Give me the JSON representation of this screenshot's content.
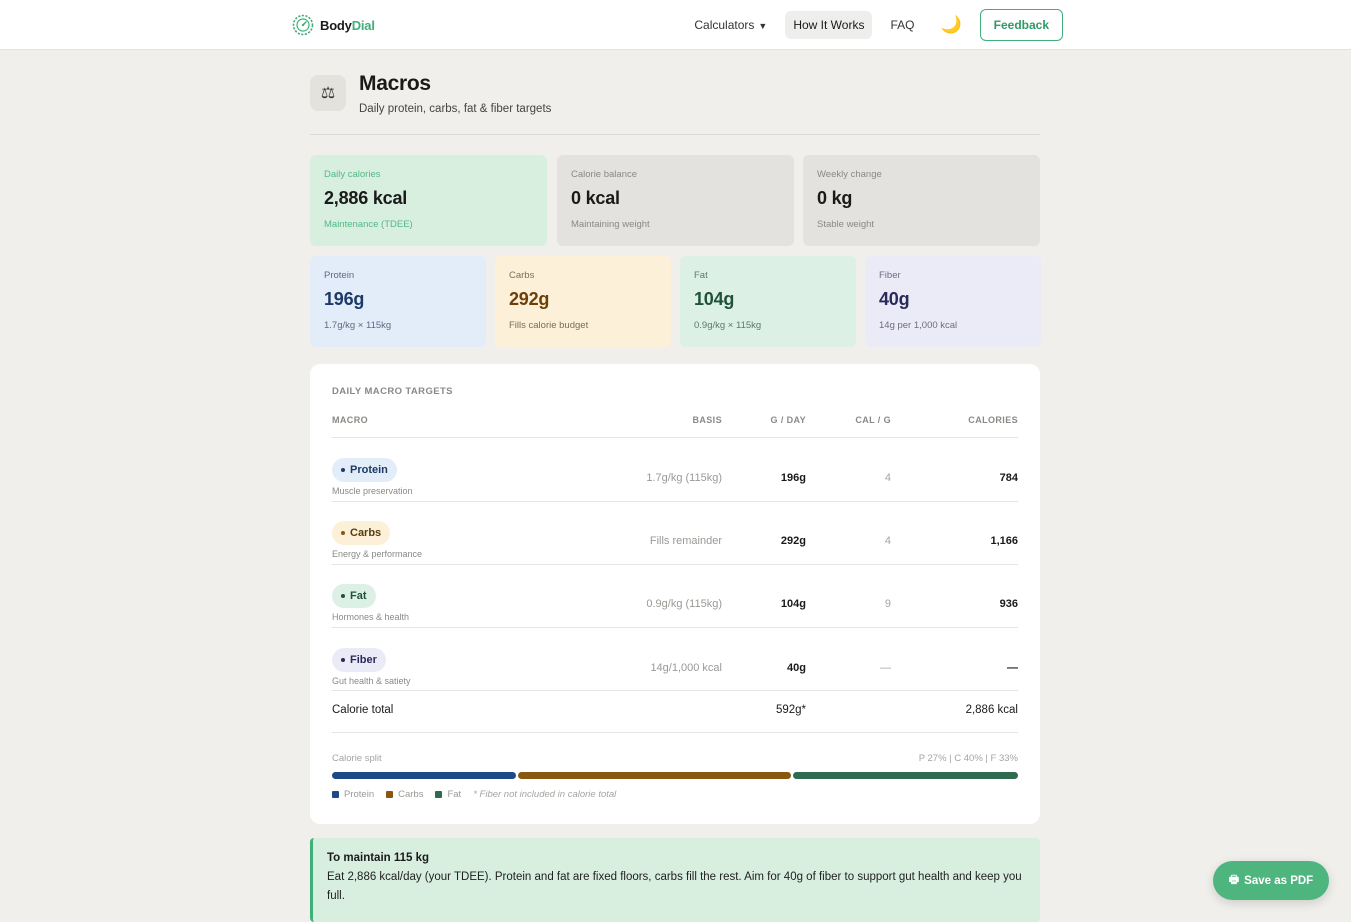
{
  "brand": {
    "name_part1": "Body",
    "name_part2": "Dial",
    "logo_icon": "dial-gauge-icon",
    "accent": "#3fb07a"
  },
  "nav": {
    "calculators": "Calculators",
    "how_it_works": "How It Works",
    "faq": "FAQ",
    "theme_icon": "moon-icon",
    "feedback": "Feedback"
  },
  "header": {
    "icon": "scale-balance-icon",
    "title": "Macros",
    "subtitle": "Daily protein, carbs, fat & fiber targets"
  },
  "summary_cards": [
    {
      "label": "Daily calories",
      "value": "2,886 kcal",
      "note": "Maintenance (TDEE)"
    },
    {
      "label": "Calorie balance",
      "value": "0 kcal",
      "note": "Maintaining weight"
    },
    {
      "label": "Weekly change",
      "value": "0 kg",
      "note": "Stable weight"
    }
  ],
  "macro_cards": [
    {
      "label": "Protein",
      "value": "196g",
      "note": "1.7g/kg × 115kg"
    },
    {
      "label": "Carbs",
      "value": "292g",
      "note": "Fills calorie budget"
    },
    {
      "label": "Fat",
      "value": "104g",
      "note": "0.9g/kg × 115kg"
    },
    {
      "label": "Fiber",
      "value": "40g",
      "note": "14g per 1,000 kcal"
    }
  ],
  "table": {
    "title": "DAILY MACRO TARGETS",
    "headers": {
      "macro": "MACRO",
      "basis": "BASIS",
      "grams": "G / DAY",
      "cal_per_g": "CAL / G",
      "calories": "CALORIES"
    },
    "rows": [
      {
        "name": "Protein",
        "desc": "Muscle preservation",
        "basis": "1.7g/kg (115kg)",
        "grams": "196g",
        "cal_per_g": "4",
        "calories": "784"
      },
      {
        "name": "Carbs",
        "desc": "Energy & performance",
        "basis": "Fills remainder",
        "grams": "292g",
        "cal_per_g": "4",
        "calories": "1,166"
      },
      {
        "name": "Fat",
        "desc": "Hormones & health",
        "basis": "0.9g/kg (115kg)",
        "grams": "104g",
        "cal_per_g": "9",
        "calories": "936"
      },
      {
        "name": "Fiber",
        "desc": "Gut health & satiety",
        "basis": "14g/1,000 kcal",
        "grams": "40g",
        "cal_per_g": "—",
        "calories": "—"
      }
    ],
    "total": {
      "label": "Calorie total",
      "grams": "592g*",
      "calories": "2,886 kcal"
    }
  },
  "split": {
    "label": "Calorie split",
    "summary": "P 27% | C 40% | F 33%",
    "segments": [
      {
        "name": "Protein",
        "percent": 27,
        "color": "#1d4a86"
      },
      {
        "name": "Carbs",
        "percent": 40,
        "color": "#8a5710"
      },
      {
        "name": "Fat",
        "percent": 33,
        "color": "#2f6b4f"
      }
    ],
    "footnote": "* Fiber not included in calorie total"
  },
  "maintain": {
    "title": "To maintain 115 kg",
    "text": "Eat 2,886 kcal/day (your TDEE). Protein and fat are fixed floors, carbs fill the rest. Aim for 40g of fiber to support gut health and keep you full."
  },
  "actions": {
    "save_pdf": "Save as PDF",
    "save_pdf_icon": "printer-icon"
  }
}
